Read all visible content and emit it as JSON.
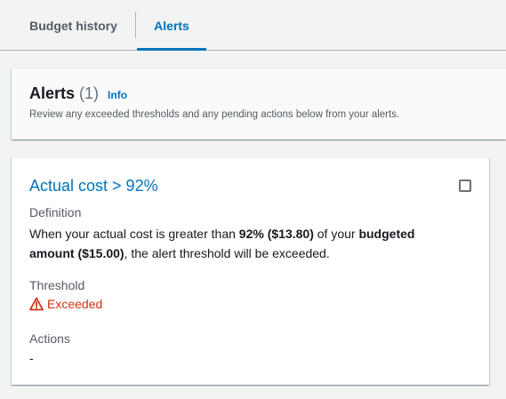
{
  "tabs": {
    "budget_history": "Budget history",
    "alerts": "Alerts",
    "active": "alerts"
  },
  "header": {
    "title": "Alerts",
    "count": "(1)",
    "info_link": "Info",
    "description": "Review any exceeded thresholds and any pending actions below from your alerts."
  },
  "alert": {
    "title": "Actual cost > 92%",
    "checked": false,
    "definition_label": "Definition",
    "definition": {
      "part1": "When your actual cost is greater than ",
      "bold1": "92% ($13.80)",
      "part2": " of your ",
      "bold2": "budgeted amount ($15.00)",
      "part3": ", the alert threshold will be exceeded."
    },
    "threshold_label": "Threshold",
    "threshold_status": "Exceeded",
    "threshold_icon": "warning-icon",
    "actions_label": "Actions",
    "actions_value": "-"
  },
  "colors": {
    "link": "#0073bb",
    "error": "#d13212",
    "background": "#f2f3f3"
  }
}
